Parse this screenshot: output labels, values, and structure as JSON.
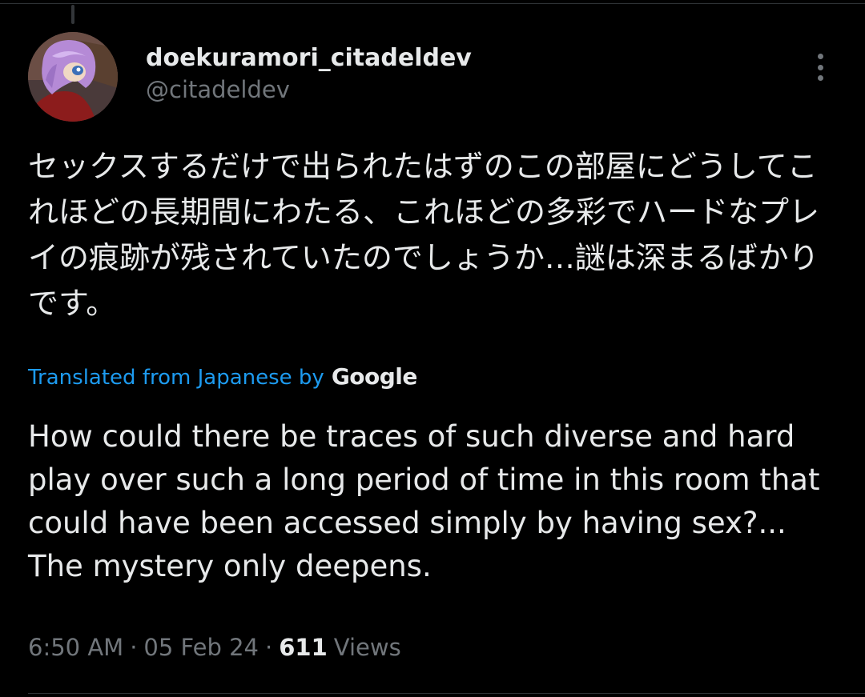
{
  "author": {
    "display_name": "doekuramori_citadeldev",
    "handle": "@citadeldev"
  },
  "tweet": {
    "text_ja": "セックスするだけで出られたはずのこの部屋にどうしてこれほどの長期間にわたる、これほどの多彩でハードなプレイの痕跡が残されていたのでしょうか…謎は深まるばかりです。",
    "translation_label": "Translated from Japanese by",
    "translation_provider": "Google",
    "text_en": "How could there be traces of such diverse and hard play over such a long period of time in this room that could have been accessed simply by having sex?... The mystery only deepens."
  },
  "meta": {
    "time": "6:50 AM",
    "separator": "·",
    "date": "05 Feb 24",
    "views_count": "611",
    "views_label": "Views"
  },
  "colors": {
    "background": "#000000",
    "text": "#e7e9ea",
    "secondary": "#71767b",
    "link": "#1d9bf0",
    "divider": "#2f3336"
  },
  "icons": {
    "more": "more-vertical-icon"
  }
}
